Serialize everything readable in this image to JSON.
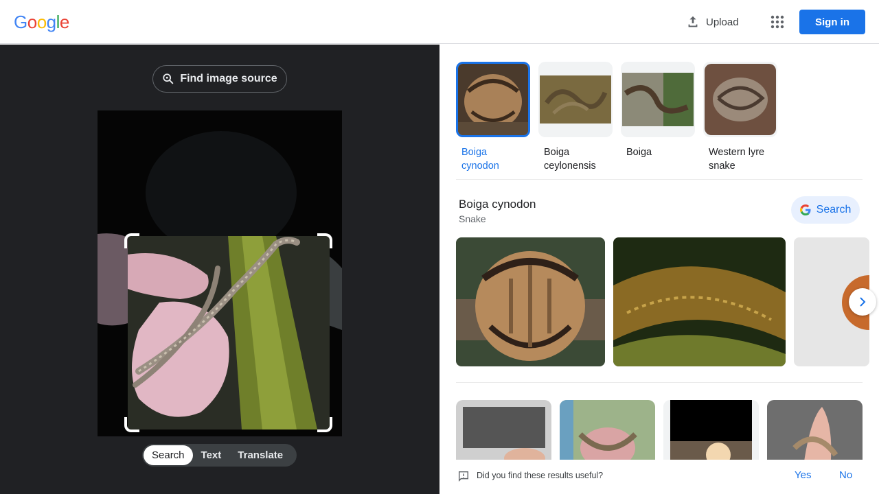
{
  "header": {
    "logo_letters": [
      "G",
      "o",
      "o",
      "g",
      "l",
      "e"
    ],
    "upload_label": "Upload",
    "signin_label": "Sign in"
  },
  "lens": {
    "find_source_label": "Find image source",
    "modes": [
      {
        "label": "Search",
        "active": true
      },
      {
        "label": "Text",
        "active": false
      },
      {
        "label": "Translate",
        "active": false
      }
    ]
  },
  "matches": [
    {
      "label": "Boiga cynodon",
      "selected": true
    },
    {
      "label": "Boiga ceylonensis",
      "selected": false
    },
    {
      "label": "Boiga",
      "selected": false
    },
    {
      "label": "Western lyre snake",
      "selected": false
    }
  ],
  "entity": {
    "title": "Boiga cynodon",
    "subtitle": "Snake",
    "search_label": "Search"
  },
  "feedback": {
    "question": "Did you find these results useful?",
    "yes_label": "Yes",
    "no_label": "No"
  },
  "colors": {
    "accent": "#1a73e8",
    "dark_panel": "#202124",
    "logo": [
      "#4285f4",
      "#ea4335",
      "#fbbc05",
      "#4285f4",
      "#34a853",
      "#ea4335"
    ]
  }
}
